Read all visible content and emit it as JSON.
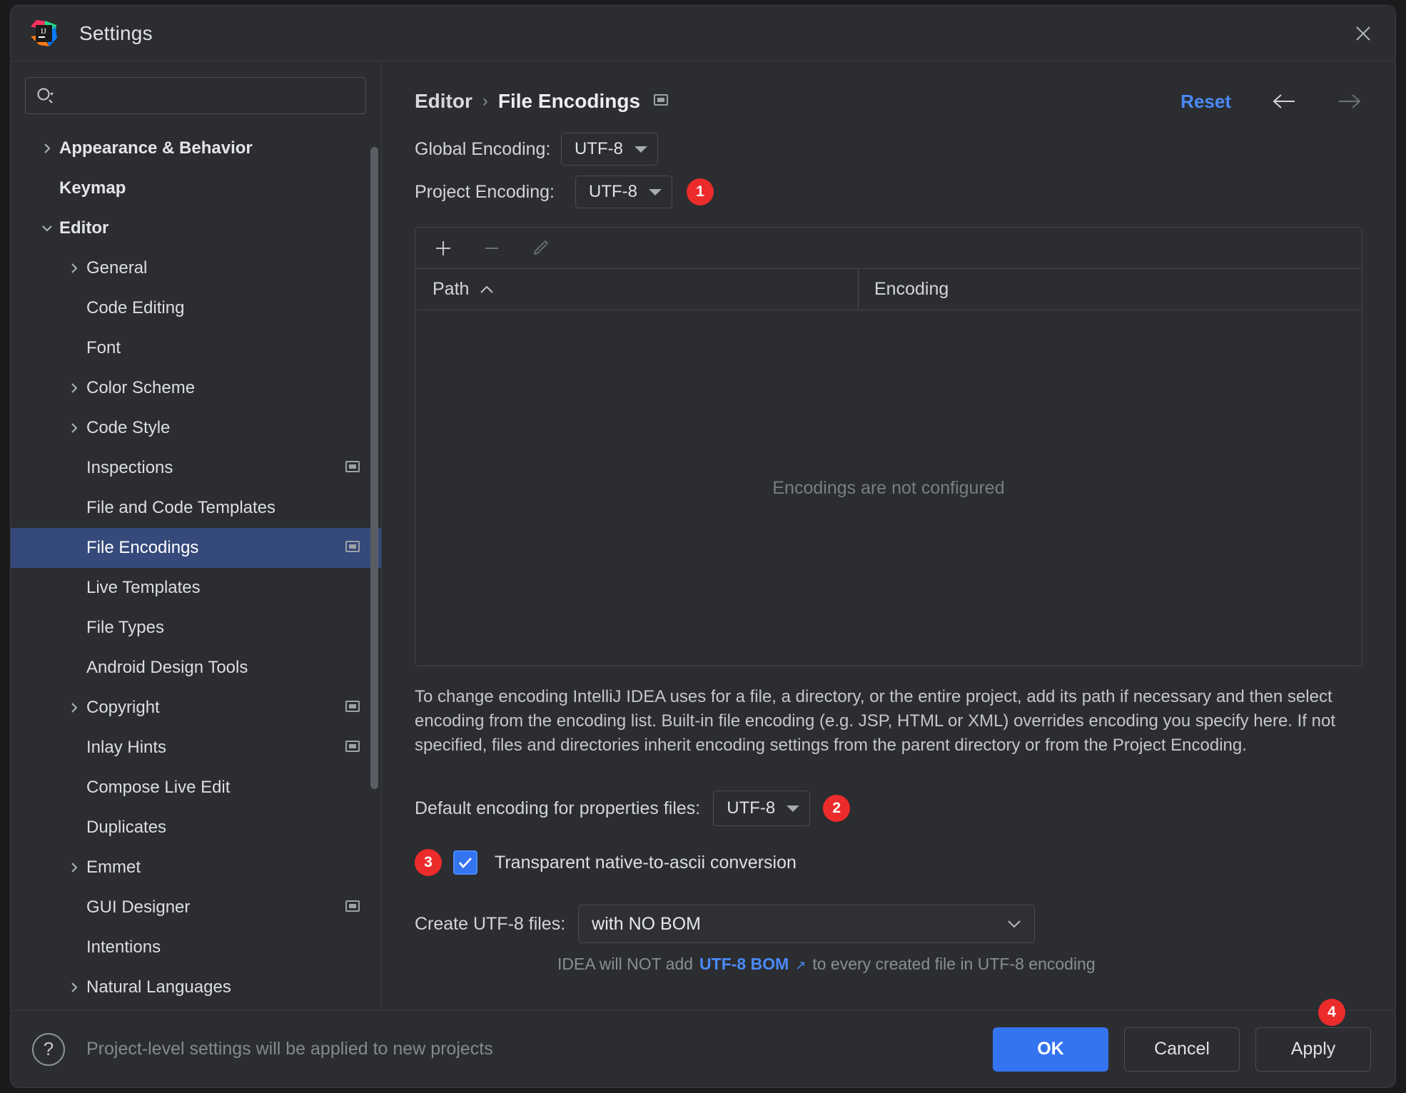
{
  "window": {
    "title": "Settings",
    "logo_icon": "intellij-idea-logo",
    "close_icon": "close-icon"
  },
  "search": {
    "value": "",
    "placeholder": "",
    "icon": "search-icon"
  },
  "sidebar": {
    "items": [
      {
        "label": "Appearance & Behavior",
        "level": 0,
        "twisty": "chevron-right-icon",
        "bold": true,
        "selected": false,
        "badge": false
      },
      {
        "label": "Keymap",
        "level": 0,
        "twisty": "",
        "bold": true,
        "selected": false,
        "badge": false
      },
      {
        "label": "Editor",
        "level": 0,
        "twisty": "chevron-down-icon",
        "bold": true,
        "selected": false,
        "badge": false
      },
      {
        "label": "General",
        "level": 1,
        "twisty": "chevron-right-icon",
        "bold": false,
        "selected": false,
        "badge": false
      },
      {
        "label": "Code Editing",
        "level": 1,
        "twisty": "",
        "bold": false,
        "selected": false,
        "badge": false
      },
      {
        "label": "Font",
        "level": 1,
        "twisty": "",
        "bold": false,
        "selected": false,
        "badge": false
      },
      {
        "label": "Color Scheme",
        "level": 1,
        "twisty": "chevron-right-icon",
        "bold": false,
        "selected": false,
        "badge": false
      },
      {
        "label": "Code Style",
        "level": 1,
        "twisty": "chevron-right-icon",
        "bold": false,
        "selected": false,
        "badge": false
      },
      {
        "label": "Inspections",
        "level": 1,
        "twisty": "",
        "bold": false,
        "selected": false,
        "badge": true
      },
      {
        "label": "File and Code Templates",
        "level": 1,
        "twisty": "",
        "bold": false,
        "selected": false,
        "badge": false
      },
      {
        "label": "File Encodings",
        "level": 1,
        "twisty": "",
        "bold": false,
        "selected": true,
        "badge": true
      },
      {
        "label": "Live Templates",
        "level": 1,
        "twisty": "",
        "bold": false,
        "selected": false,
        "badge": false
      },
      {
        "label": "File Types",
        "level": 1,
        "twisty": "",
        "bold": false,
        "selected": false,
        "badge": false
      },
      {
        "label": "Android Design Tools",
        "level": 1,
        "twisty": "",
        "bold": false,
        "selected": false,
        "badge": false
      },
      {
        "label": "Copyright",
        "level": 1,
        "twisty": "chevron-right-icon",
        "bold": false,
        "selected": false,
        "badge": true
      },
      {
        "label": "Inlay Hints",
        "level": 1,
        "twisty": "",
        "bold": false,
        "selected": false,
        "badge": true
      },
      {
        "label": "Compose Live Edit",
        "level": 1,
        "twisty": "",
        "bold": false,
        "selected": false,
        "badge": false
      },
      {
        "label": "Duplicates",
        "level": 1,
        "twisty": "",
        "bold": false,
        "selected": false,
        "badge": false
      },
      {
        "label": "Emmet",
        "level": 1,
        "twisty": "chevron-right-icon",
        "bold": false,
        "selected": false,
        "badge": false
      },
      {
        "label": "GUI Designer",
        "level": 1,
        "twisty": "",
        "bold": false,
        "selected": false,
        "badge": true
      },
      {
        "label": "Intentions",
        "level": 1,
        "twisty": "",
        "bold": false,
        "selected": false,
        "badge": false
      },
      {
        "label": "Natural Languages",
        "level": 1,
        "twisty": "chevron-right-icon",
        "bold": false,
        "selected": false,
        "badge": false
      }
    ]
  },
  "breadcrumb": {
    "parent": "Editor",
    "separator": "›",
    "current": "File Encodings",
    "badge_icon": "project-level-settings-icon"
  },
  "header": {
    "reset_label": "Reset",
    "back_icon": "arrow-left-icon",
    "forward_icon": "arrow-right-icon"
  },
  "encodings": {
    "global_label": "Global Encoding:",
    "global_value": "UTF-8",
    "project_label": "Project Encoding:",
    "project_value": "UTF-8",
    "project_marker": "1"
  },
  "table": {
    "toolbar": {
      "add_icon": "plus-icon",
      "remove_icon": "minus-icon",
      "edit_icon": "pencil-icon"
    },
    "columns": [
      "Path",
      "Encoding"
    ],
    "sort_icon": "chevron-up-icon",
    "rows": [],
    "empty_text": "Encodings are not configured"
  },
  "description": "To change encoding IntelliJ IDEA uses for a file, a directory, or the entire project, add its path if necessary and then select encoding from the encoding list. Built-in file encoding (e.g. JSP, HTML or XML) overrides encoding you specify here. If not specified, files and directories inherit encoding settings from the parent directory or from the Project Encoding.",
  "properties": {
    "label": "Default encoding for properties files:",
    "value": "UTF-8",
    "marker": "2"
  },
  "native_ascii": {
    "marker": "3",
    "checked": true,
    "label": "Transparent native-to-ascii conversion"
  },
  "bom": {
    "label": "Create UTF-8 files:",
    "value": "with NO BOM",
    "dropdown_icon": "chevron-down-icon",
    "hint_prefix": "IDEA will NOT add",
    "hint_link": "UTF-8 BOM",
    "hint_link_icon": "external-link-icon",
    "hint_suffix": "to every created file in UTF-8 encoding"
  },
  "footer": {
    "help_icon": "question-mark-icon",
    "note": "Project-level settings will be applied to new projects",
    "ok_label": "OK",
    "cancel_label": "Cancel",
    "apply_label": "Apply",
    "apply_marker": "4"
  },
  "colors": {
    "accent": "#3574f0",
    "link": "#4a8af8",
    "selection": "#35497a",
    "marker_red": "#ec2b2b",
    "panel_bg": "#2b2d30"
  }
}
